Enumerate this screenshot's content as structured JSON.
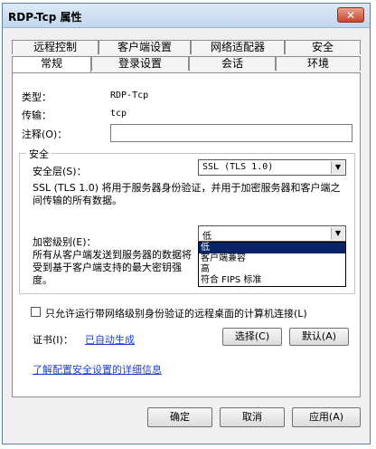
{
  "window": {
    "title": "RDP-Tcp 属性",
    "close_glyph": "✕"
  },
  "tabs": {
    "row1": [
      "远程控制",
      "客户端设置",
      "网络适配器",
      "安全"
    ],
    "row2": [
      "常规",
      "登录设置",
      "会话",
      "环境"
    ],
    "active": "常规"
  },
  "general": {
    "type_label": "类型：",
    "type_value": "RDP-Tcp",
    "transport_label": "传输：",
    "transport_value": "tcp",
    "comment_label": "注释(O)：",
    "comment_value": ""
  },
  "security": {
    "group_title": "安全",
    "layer_label": "安全层(S)：",
    "layer_value": "SSL (TLS 1.0)",
    "layer_description": "SSL (TLS 1.0) 将用于服务器身份验证，并用于加密服务器和客户端之间传输的所有数据。",
    "encryption_label": "加密级别(E)：",
    "encryption_value": "低",
    "encryption_options": [
      "低",
      "客户端兼容",
      "高",
      "符合 FIPS 标准"
    ],
    "encryption_selected_index": 0,
    "encryption_description": "所有从客户端发送到服务器的数据将受到基于客户端支持的最大密钥强度。"
  },
  "nla_checkbox": {
    "label": "只允许运行带网络级别身份验证的远程桌面的计算机连接(L)",
    "checked": false
  },
  "certificate": {
    "label": "证书(I)：",
    "value_link": "已自动生成",
    "select_button": "选择(C)",
    "default_button": "默认(A)"
  },
  "learn_more_link": "了解配置安全设置的详细信息",
  "footer": {
    "ok": "确定",
    "cancel": "取消",
    "apply": "应用(A)"
  }
}
